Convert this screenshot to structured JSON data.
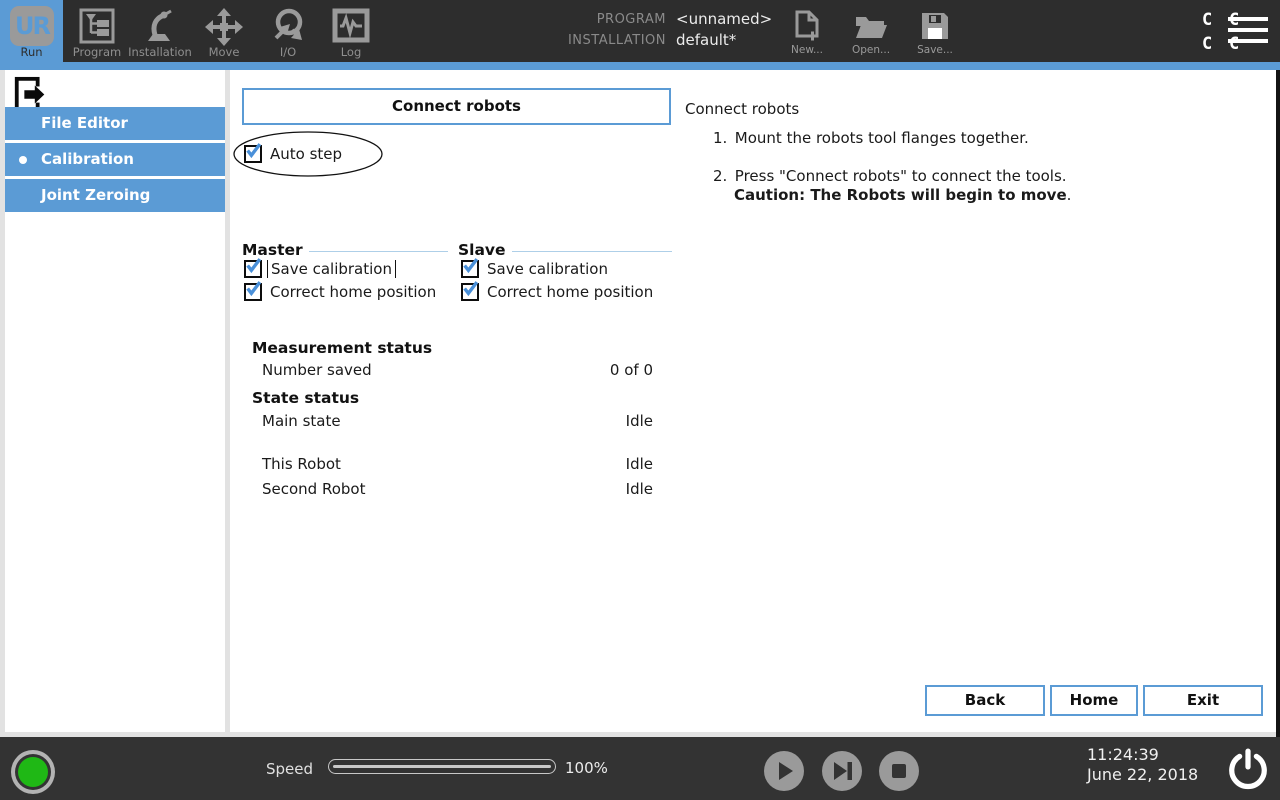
{
  "colors": {
    "accent_blue": "#5b9bd5",
    "check_blue": "#4a90d9",
    "header_bg": "#2d2d2d",
    "footer_bg": "#333333",
    "page_bg": "#e2e2e2",
    "status_green": "#1fb815",
    "icon_gray": "#9a9a9a"
  },
  "header": {
    "logo_text": "UR",
    "tabs": [
      {
        "label": "Run",
        "active": true
      },
      {
        "label": "Program"
      },
      {
        "label": "Installation"
      },
      {
        "label": "Move"
      },
      {
        "label": "I/O"
      },
      {
        "label": "Log"
      }
    ],
    "program_label": "PROGRAM",
    "program_value": "<unnamed>",
    "installation_label": "INSTALLATION",
    "installation_value": "default*",
    "actions": [
      {
        "label": "New..."
      },
      {
        "label": "Open..."
      },
      {
        "label": "Save..."
      }
    ],
    "corner_chars": [
      "C",
      "C",
      "C",
      "C"
    ]
  },
  "sidebar": {
    "items": [
      {
        "label": "File Editor",
        "bullet": false
      },
      {
        "label": "Calibration",
        "bullet": true
      },
      {
        "label": "Joint Zeroing",
        "bullet": false
      }
    ]
  },
  "main": {
    "connect_button_label": "Connect robots",
    "auto_step": {
      "label": "Auto step",
      "checked": true
    },
    "master": {
      "title": "Master",
      "checkboxes": [
        {
          "label": "Save calibration",
          "checked": true,
          "focused": true
        },
        {
          "label": "Correct home position",
          "checked": true
        }
      ]
    },
    "slave": {
      "title": "Slave",
      "checkboxes": [
        {
          "label": "Save calibration",
          "checked": true
        },
        {
          "label": "Correct home position",
          "checked": true
        }
      ]
    },
    "measurement": {
      "title": "Measurement status",
      "rows": [
        {
          "label": "Number saved",
          "value": "0 of 0"
        }
      ]
    },
    "state": {
      "title": "State status",
      "rows": [
        {
          "label": "Main state",
          "value": "Idle"
        },
        {
          "label": "This Robot",
          "value": "Idle"
        },
        {
          "label": "Second Robot",
          "value": "Idle"
        }
      ]
    },
    "nav_buttons": [
      {
        "label": "Back"
      },
      {
        "label": "Home"
      },
      {
        "label": "Exit"
      }
    ]
  },
  "instructions": {
    "title": "Connect robots",
    "steps": [
      {
        "num": "1.",
        "text": "Mount the robots tool flanges together."
      },
      {
        "num": "2.",
        "text": "Press \"Connect robots\" to connect the tools.",
        "caution": "Caution: The Robots will begin to move",
        "caution_suffix": "."
      }
    ]
  },
  "footer": {
    "speed_label": "Speed",
    "speed_percent": "100%",
    "time": "11:24:39",
    "date": "June 22, 2018"
  }
}
